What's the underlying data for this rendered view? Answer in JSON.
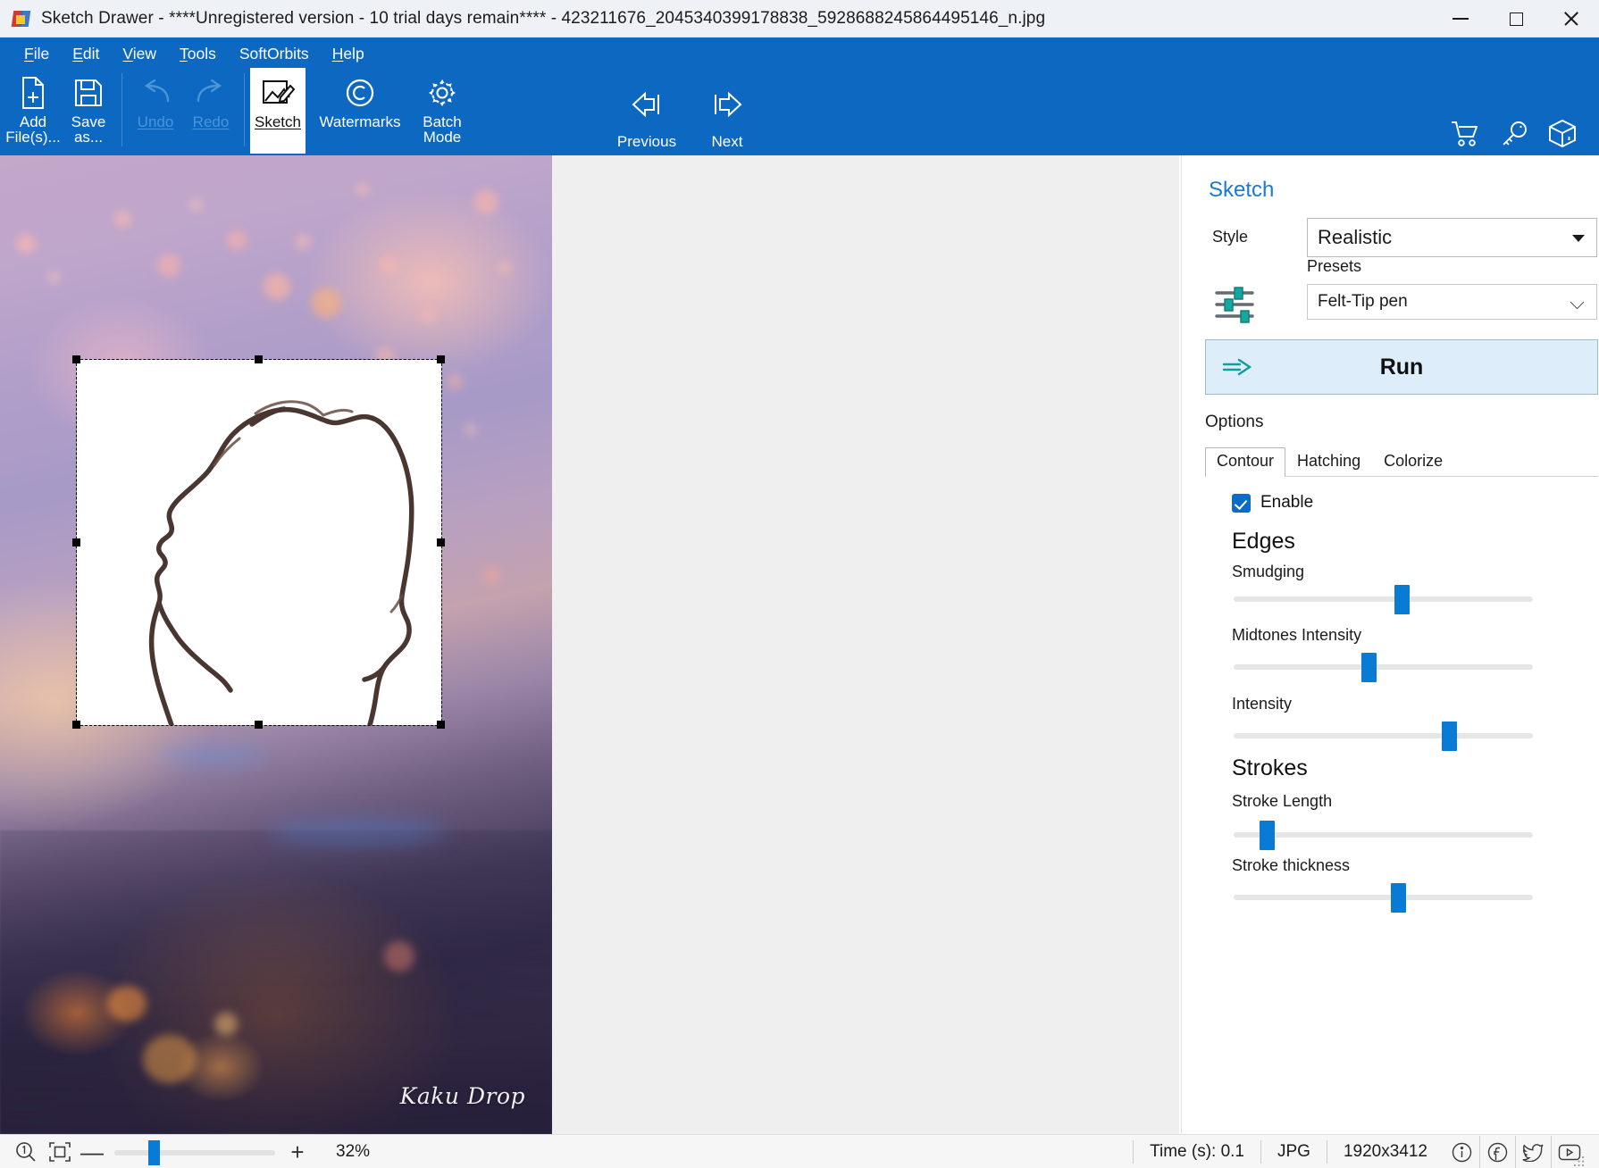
{
  "window": {
    "title": "Sketch Drawer - ****Unregistered version - 10 trial days remain**** - 423211676_2045340399178838_5928688245864495146_n.jpg",
    "app_icon": "sketch-drawer-logo",
    "minimize": "—",
    "maximize": "□",
    "close": "✕"
  },
  "menubar": {
    "items": [
      {
        "label": "File",
        "accel": "F"
      },
      {
        "label": "Edit",
        "accel": "E"
      },
      {
        "label": "View",
        "accel": "V"
      },
      {
        "label": "Tools",
        "accel": "T"
      },
      {
        "label": "SoftOrbits",
        "accel": ""
      },
      {
        "label": "Help",
        "accel": "H"
      }
    ]
  },
  "toolbar": {
    "items": [
      {
        "label": "Add\nFile(s)...",
        "icon": "add-file-icon",
        "state": "enabled"
      },
      {
        "label": "Save\nas...",
        "icon": "save-icon",
        "state": "enabled"
      },
      {
        "label": "Undo",
        "icon": "undo-icon",
        "state": "disabled"
      },
      {
        "label": "Redo",
        "icon": "redo-icon",
        "state": "disabled"
      },
      {
        "label": "Sketch",
        "icon": "sketch-icon",
        "state": "active"
      },
      {
        "label": "Watermarks",
        "icon": "copyright-icon",
        "state": "enabled"
      },
      {
        "label": "Batch\nMode",
        "icon": "gear-icon",
        "state": "enabled"
      }
    ],
    "nav": [
      {
        "label": "Previous",
        "icon": "arrow-left-icon"
      },
      {
        "label": "Next",
        "icon": "arrow-right-icon"
      }
    ],
    "right_icons": [
      {
        "name": "cart-icon"
      },
      {
        "name": "key-icon"
      },
      {
        "name": "box-icon"
      }
    ]
  },
  "canvas": {
    "watermark_text": "Kaku Drop",
    "selection_label": "sketch-preview-selection"
  },
  "panel": {
    "title": "Sketch",
    "style_label": "Style",
    "style_value": "Realistic",
    "presets_label": "Presets",
    "presets_value": "Felt-Tip pen",
    "run_label": "Run",
    "options_label": "Options",
    "tabs": [
      {
        "label": "Contour",
        "active": true
      },
      {
        "label": "Hatching",
        "active": false
      },
      {
        "label": "Colorize",
        "active": false
      }
    ],
    "enable_label": "Enable",
    "enable_checked": true,
    "sections": [
      {
        "heading": "Edges",
        "controls": [
          {
            "label": "Smudging",
            "value": 56
          },
          {
            "label": "Midtones Intensity",
            "value": 45
          },
          {
            "label": "Intensity",
            "value": 72
          }
        ]
      },
      {
        "heading": "Strokes",
        "controls": [
          {
            "label": "Stroke Length",
            "value": 11
          },
          {
            "label": "Stroke thickness",
            "value": 55
          }
        ]
      }
    ],
    "accent_color": "#0a7bd4",
    "title_color": "#1a7ad4"
  },
  "statusbar": {
    "zoom_icon": "zoom-1to1-icon",
    "fit_icon": "fit-to-window-icon",
    "zoom_out": "—",
    "zoom_in": "+",
    "zoom_value": 32,
    "zoom_percent": "32%",
    "time_label": "Time (s): 0.1",
    "format_label": "JPG",
    "dimensions_label": "1920x3412",
    "icons": [
      {
        "name": "info-icon"
      },
      {
        "name": "facebook-icon"
      },
      {
        "name": "twitter-icon"
      },
      {
        "name": "youtube-icon"
      }
    ]
  }
}
